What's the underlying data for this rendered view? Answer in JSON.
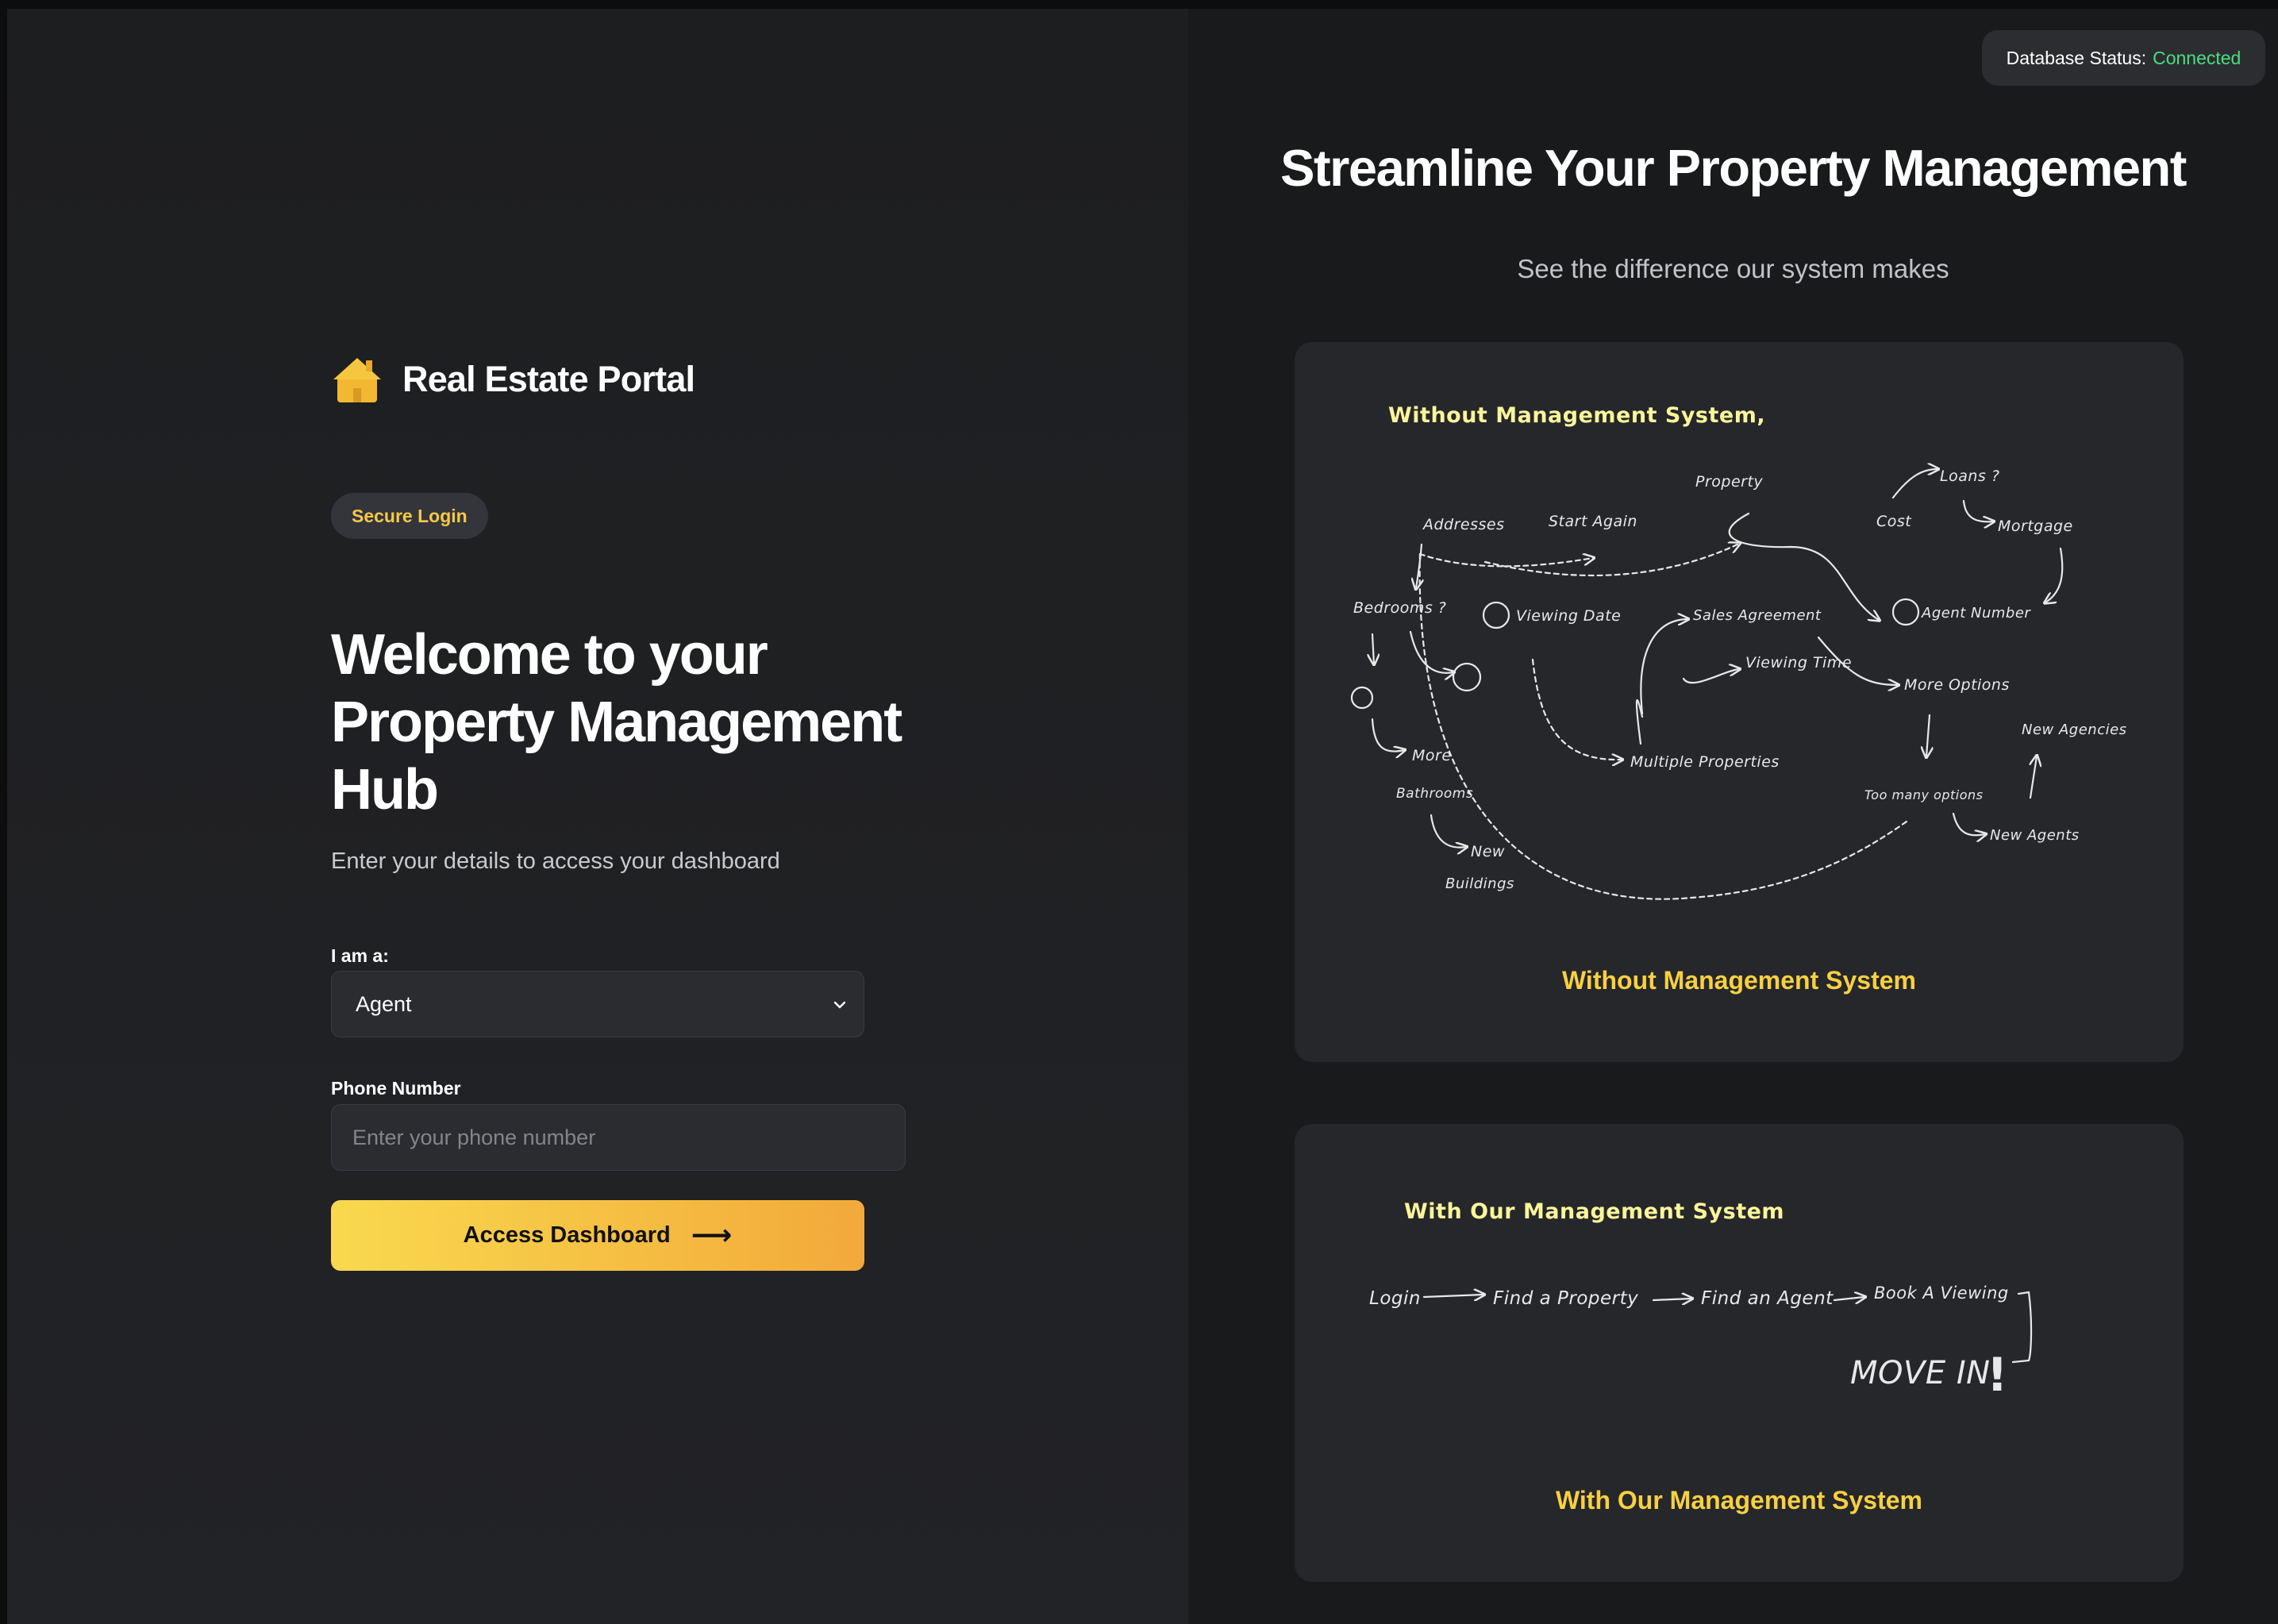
{
  "login": {
    "brand": {
      "icon": "house-icon",
      "name": "Real Estate Portal"
    },
    "badge": "Secure Login",
    "heading": "Welcome to your Property Management Hub",
    "subtitle": "Enter your details to access your dashboard",
    "role_label": "I am a:",
    "role_value": "Agent",
    "phone_label": "Phone Number",
    "phone_placeholder": "Enter your phone number",
    "phone_value": "",
    "submit_label": "Access Dashboard",
    "submit_icon": "arrow-right-icon"
  },
  "status": {
    "label": "Database Status:",
    "value": "Connected",
    "color": "#4ade80"
  },
  "showcase": {
    "headline": "Streamline Your Property Management",
    "tagline": "See the difference our system makes",
    "without": {
      "sketch_title": "Without Management System,",
      "nodes": [
        "Addresses",
        "Start Again",
        "Property",
        "Loans ?",
        "Cost",
        "Mortgage",
        "Bedrooms ?",
        "Viewing Date",
        "Sales Agreement",
        "Agent Number",
        "Viewing Time",
        "More Options",
        "New Agencies",
        "More",
        "Bathrooms",
        "Multiple Properties",
        "Too many options",
        "New Agents",
        "New",
        "Buildings"
      ],
      "caption": "Without Management System"
    },
    "with": {
      "sketch_title": "With Our Management System",
      "steps": [
        "Login",
        "Find a Property",
        "Find an Agent",
        "Book A Viewing"
      ],
      "final": "MOVE IN",
      "caption": "With Our Management System"
    }
  },
  "colors": {
    "accent": "#f8d040",
    "gradient_start": "#f9d94e",
    "gradient_end": "#f2a93a"
  }
}
